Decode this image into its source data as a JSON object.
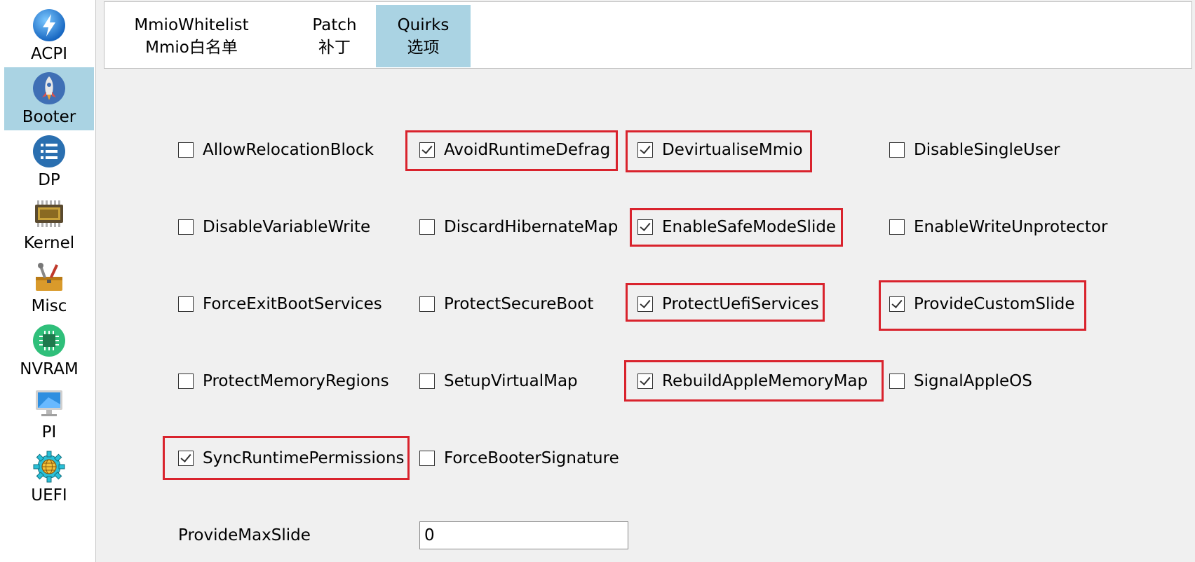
{
  "sidebar": {
    "items": [
      {
        "label": "ACPI",
        "icon": "lightning-icon"
      },
      {
        "label": "Booter",
        "icon": "rocket-icon"
      },
      {
        "label": "DP",
        "icon": "list-icon"
      },
      {
        "label": "Kernel",
        "icon": "chip-icon"
      },
      {
        "label": "Misc",
        "icon": "toolbox-icon"
      },
      {
        "label": "NVRAM",
        "icon": "memory-chip-icon"
      },
      {
        "label": "PI",
        "icon": "monitor-icon"
      },
      {
        "label": "UEFI",
        "icon": "gear-globe-icon"
      }
    ],
    "selected": "Booter"
  },
  "tabs": [
    {
      "title": "MmioWhitelist",
      "subtitle": "Mmio白名单"
    },
    {
      "title": "Patch",
      "subtitle": "补丁"
    },
    {
      "title": "Quirks",
      "subtitle": "选项"
    }
  ],
  "active_tab": "Quirks",
  "quirks": [
    {
      "label": "AllowRelocationBlock",
      "checked": false
    },
    {
      "label": "AvoidRuntimeDefrag",
      "checked": true
    },
    {
      "label": "DevirtualiseMmio",
      "checked": true
    },
    {
      "label": "DisableSingleUser",
      "checked": false
    },
    {
      "label": "DisableVariableWrite",
      "checked": false
    },
    {
      "label": "DiscardHibernateMap",
      "checked": false
    },
    {
      "label": "EnableSafeModeSlide",
      "checked": true
    },
    {
      "label": "EnableWriteUnprotector",
      "checked": false
    },
    {
      "label": "ForceExitBootServices",
      "checked": false
    },
    {
      "label": "ProtectSecureBoot",
      "checked": false
    },
    {
      "label": "ProtectUefiServices",
      "checked": true
    },
    {
      "label": "ProvideCustomSlide",
      "checked": true
    },
    {
      "label": "ProtectMemoryRegions",
      "checked": false
    },
    {
      "label": "SetupVirtualMap",
      "checked": false
    },
    {
      "label": "RebuildAppleMemoryMap",
      "checked": true
    },
    {
      "label": "SignalAppleOS",
      "checked": false
    },
    {
      "label": "SyncRuntimePermissions",
      "checked": true
    },
    {
      "label": "ForceBooterSignature",
      "checked": false
    }
  ],
  "provide_max_slide": {
    "label": "ProvideMaxSlide",
    "value": "0"
  },
  "colors": {
    "highlight": "#d9232d",
    "selected": "#aad3e3"
  }
}
